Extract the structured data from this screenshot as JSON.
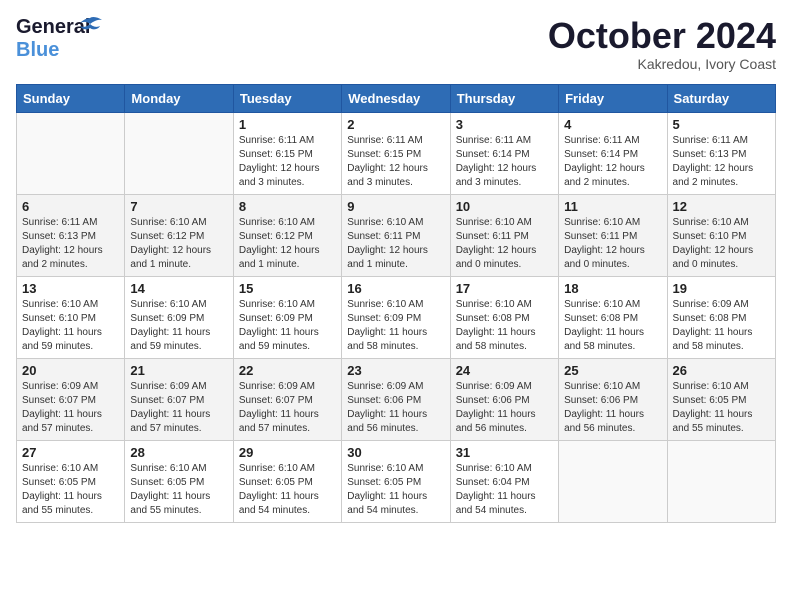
{
  "logo": {
    "line1": "General",
    "line2": "Blue"
  },
  "title": "October 2024",
  "subtitle": "Kakredou, Ivory Coast",
  "days_header": [
    "Sunday",
    "Monday",
    "Tuesday",
    "Wednesday",
    "Thursday",
    "Friday",
    "Saturday"
  ],
  "weeks": [
    [
      {
        "day": "",
        "info": ""
      },
      {
        "day": "",
        "info": ""
      },
      {
        "day": "1",
        "info": "Sunrise: 6:11 AM\nSunset: 6:15 PM\nDaylight: 12 hours and 3 minutes."
      },
      {
        "day": "2",
        "info": "Sunrise: 6:11 AM\nSunset: 6:15 PM\nDaylight: 12 hours and 3 minutes."
      },
      {
        "day": "3",
        "info": "Sunrise: 6:11 AM\nSunset: 6:14 PM\nDaylight: 12 hours and 3 minutes."
      },
      {
        "day": "4",
        "info": "Sunrise: 6:11 AM\nSunset: 6:14 PM\nDaylight: 12 hours and 2 minutes."
      },
      {
        "day": "5",
        "info": "Sunrise: 6:11 AM\nSunset: 6:13 PM\nDaylight: 12 hours and 2 minutes."
      }
    ],
    [
      {
        "day": "6",
        "info": "Sunrise: 6:11 AM\nSunset: 6:13 PM\nDaylight: 12 hours and 2 minutes."
      },
      {
        "day": "7",
        "info": "Sunrise: 6:10 AM\nSunset: 6:12 PM\nDaylight: 12 hours and 1 minute."
      },
      {
        "day": "8",
        "info": "Sunrise: 6:10 AM\nSunset: 6:12 PM\nDaylight: 12 hours and 1 minute."
      },
      {
        "day": "9",
        "info": "Sunrise: 6:10 AM\nSunset: 6:11 PM\nDaylight: 12 hours and 1 minute."
      },
      {
        "day": "10",
        "info": "Sunrise: 6:10 AM\nSunset: 6:11 PM\nDaylight: 12 hours and 0 minutes."
      },
      {
        "day": "11",
        "info": "Sunrise: 6:10 AM\nSunset: 6:11 PM\nDaylight: 12 hours and 0 minutes."
      },
      {
        "day": "12",
        "info": "Sunrise: 6:10 AM\nSunset: 6:10 PM\nDaylight: 12 hours and 0 minutes."
      }
    ],
    [
      {
        "day": "13",
        "info": "Sunrise: 6:10 AM\nSunset: 6:10 PM\nDaylight: 11 hours and 59 minutes."
      },
      {
        "day": "14",
        "info": "Sunrise: 6:10 AM\nSunset: 6:09 PM\nDaylight: 11 hours and 59 minutes."
      },
      {
        "day": "15",
        "info": "Sunrise: 6:10 AM\nSunset: 6:09 PM\nDaylight: 11 hours and 59 minutes."
      },
      {
        "day": "16",
        "info": "Sunrise: 6:10 AM\nSunset: 6:09 PM\nDaylight: 11 hours and 58 minutes."
      },
      {
        "day": "17",
        "info": "Sunrise: 6:10 AM\nSunset: 6:08 PM\nDaylight: 11 hours and 58 minutes."
      },
      {
        "day": "18",
        "info": "Sunrise: 6:10 AM\nSunset: 6:08 PM\nDaylight: 11 hours and 58 minutes."
      },
      {
        "day": "19",
        "info": "Sunrise: 6:09 AM\nSunset: 6:08 PM\nDaylight: 11 hours and 58 minutes."
      }
    ],
    [
      {
        "day": "20",
        "info": "Sunrise: 6:09 AM\nSunset: 6:07 PM\nDaylight: 11 hours and 57 minutes."
      },
      {
        "day": "21",
        "info": "Sunrise: 6:09 AM\nSunset: 6:07 PM\nDaylight: 11 hours and 57 minutes."
      },
      {
        "day": "22",
        "info": "Sunrise: 6:09 AM\nSunset: 6:07 PM\nDaylight: 11 hours and 57 minutes."
      },
      {
        "day": "23",
        "info": "Sunrise: 6:09 AM\nSunset: 6:06 PM\nDaylight: 11 hours and 56 minutes."
      },
      {
        "day": "24",
        "info": "Sunrise: 6:09 AM\nSunset: 6:06 PM\nDaylight: 11 hours and 56 minutes."
      },
      {
        "day": "25",
        "info": "Sunrise: 6:10 AM\nSunset: 6:06 PM\nDaylight: 11 hours and 56 minutes."
      },
      {
        "day": "26",
        "info": "Sunrise: 6:10 AM\nSunset: 6:05 PM\nDaylight: 11 hours and 55 minutes."
      }
    ],
    [
      {
        "day": "27",
        "info": "Sunrise: 6:10 AM\nSunset: 6:05 PM\nDaylight: 11 hours and 55 minutes."
      },
      {
        "day": "28",
        "info": "Sunrise: 6:10 AM\nSunset: 6:05 PM\nDaylight: 11 hours and 55 minutes."
      },
      {
        "day": "29",
        "info": "Sunrise: 6:10 AM\nSunset: 6:05 PM\nDaylight: 11 hours and 54 minutes."
      },
      {
        "day": "30",
        "info": "Sunrise: 6:10 AM\nSunset: 6:05 PM\nDaylight: 11 hours and 54 minutes."
      },
      {
        "day": "31",
        "info": "Sunrise: 6:10 AM\nSunset: 6:04 PM\nDaylight: 11 hours and 54 minutes."
      },
      {
        "day": "",
        "info": ""
      },
      {
        "day": "",
        "info": ""
      }
    ]
  ]
}
